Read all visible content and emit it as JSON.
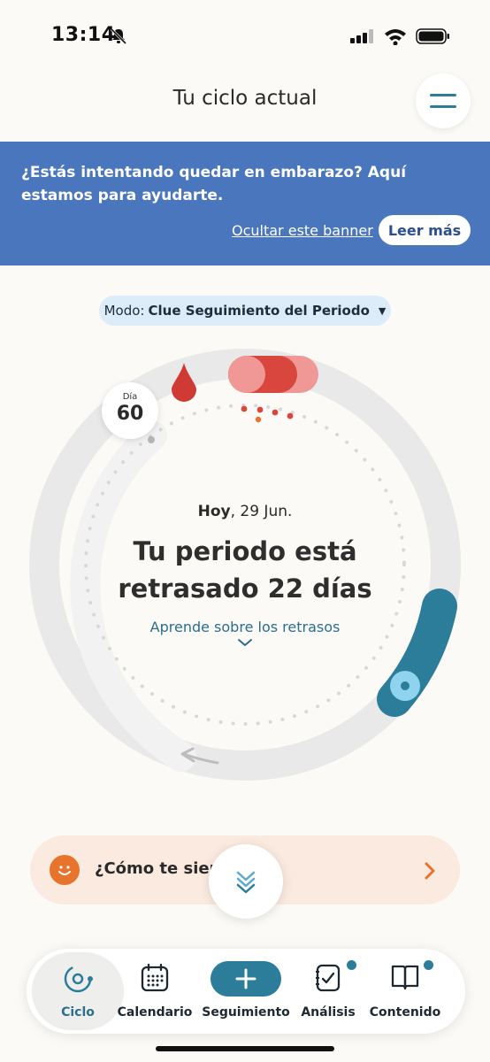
{
  "status_bar": {
    "time": "13:14",
    "icons": [
      "bell-slash-icon",
      "signal-icon",
      "wifi-icon",
      "battery-icon"
    ]
  },
  "header": {
    "title": "Tu ciclo actual",
    "menu_icon": "hamburger-menu-icon"
  },
  "banner": {
    "text": "¿Estás intentando quedar en embarazo? Aquí estamos para ayudarte.",
    "hide_label": "Ocultar este banner",
    "read_more_label": "Leer más",
    "background": "#4a76bd"
  },
  "mode": {
    "prefix": "Modo:",
    "name": "Clue Seguimiento del Periodo"
  },
  "cycle": {
    "day_label": "Día",
    "day_number": "60",
    "today_bold": "Hoy",
    "today_date": ", 29 Jun.",
    "headline": "Tu periodo está retrasado 22 días",
    "learn_link": "Aprende sobre los retrasos",
    "colors": {
      "period": "#d9463d",
      "fertile": "#2b7d9a",
      "ring": "#e9e9e9",
      "ovulation": "#8fd3ef"
    }
  },
  "feeling": {
    "label": "¿Cómo te sient",
    "icon": "smiley-icon",
    "accent": "#e8732c"
  },
  "nav": {
    "items": [
      {
        "label": "Ciclo",
        "icon": "cycle-icon",
        "active": true
      },
      {
        "label": "Calendario",
        "icon": "calendar-icon"
      },
      {
        "label": "Seguimiento",
        "icon": "plus-icon"
      },
      {
        "label": "Análisis",
        "icon": "analysis-icon",
        "badge": true
      },
      {
        "label": "Contenido",
        "icon": "book-icon",
        "badge": true
      }
    ]
  }
}
